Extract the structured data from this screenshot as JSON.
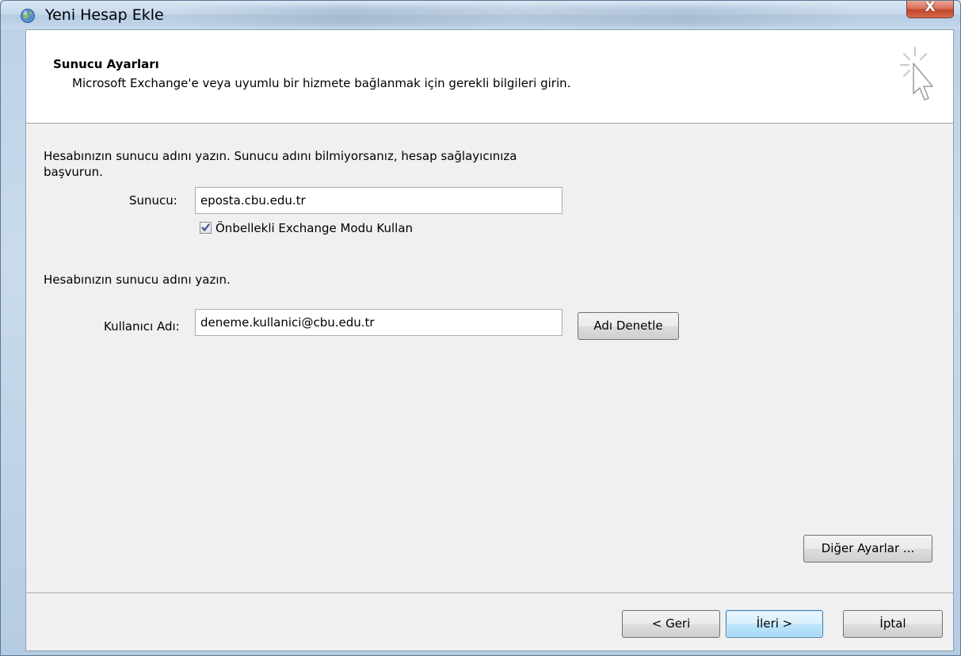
{
  "window": {
    "title": "Yeni Hesap Ekle",
    "close_label": "X"
  },
  "header": {
    "title": "Sunucu Ayarları",
    "subtitle": "Microsoft Exchange'e veya uyumlu bir hizmete bağlanmak için gerekli bilgileri girin."
  },
  "server_section": {
    "instruction_line1": "Hesabınızın sunucu adını yazın. Sunucu adını bilmiyorsanız, hesap sağlayıcınıza",
    "instruction_line2": "başvurun.",
    "server_label": "Sunucu:",
    "server_value": "eposta.cbu.edu.tr",
    "cached_mode_label": "Önbellekli Exchange Modu Kullan",
    "cached_mode_checked": true
  },
  "user_section": {
    "instruction": "Hesabınızın sunucu adını yazın.",
    "username_label": "Kullanıcı Adı:",
    "username_value": "deneme.kullanici@cbu.edu.tr",
    "check_name_button": "Adı Denetle"
  },
  "more_settings_button": "Diğer Ayarlar ...",
  "footer": {
    "back_button": "< Geri",
    "next_button": "İleri >",
    "cancel_button": "İptal"
  },
  "icons": {
    "app": "outlook-globe-icon",
    "wizard": "wizard-cursor-icon",
    "close": "close-icon",
    "check": "checkmark-icon"
  }
}
